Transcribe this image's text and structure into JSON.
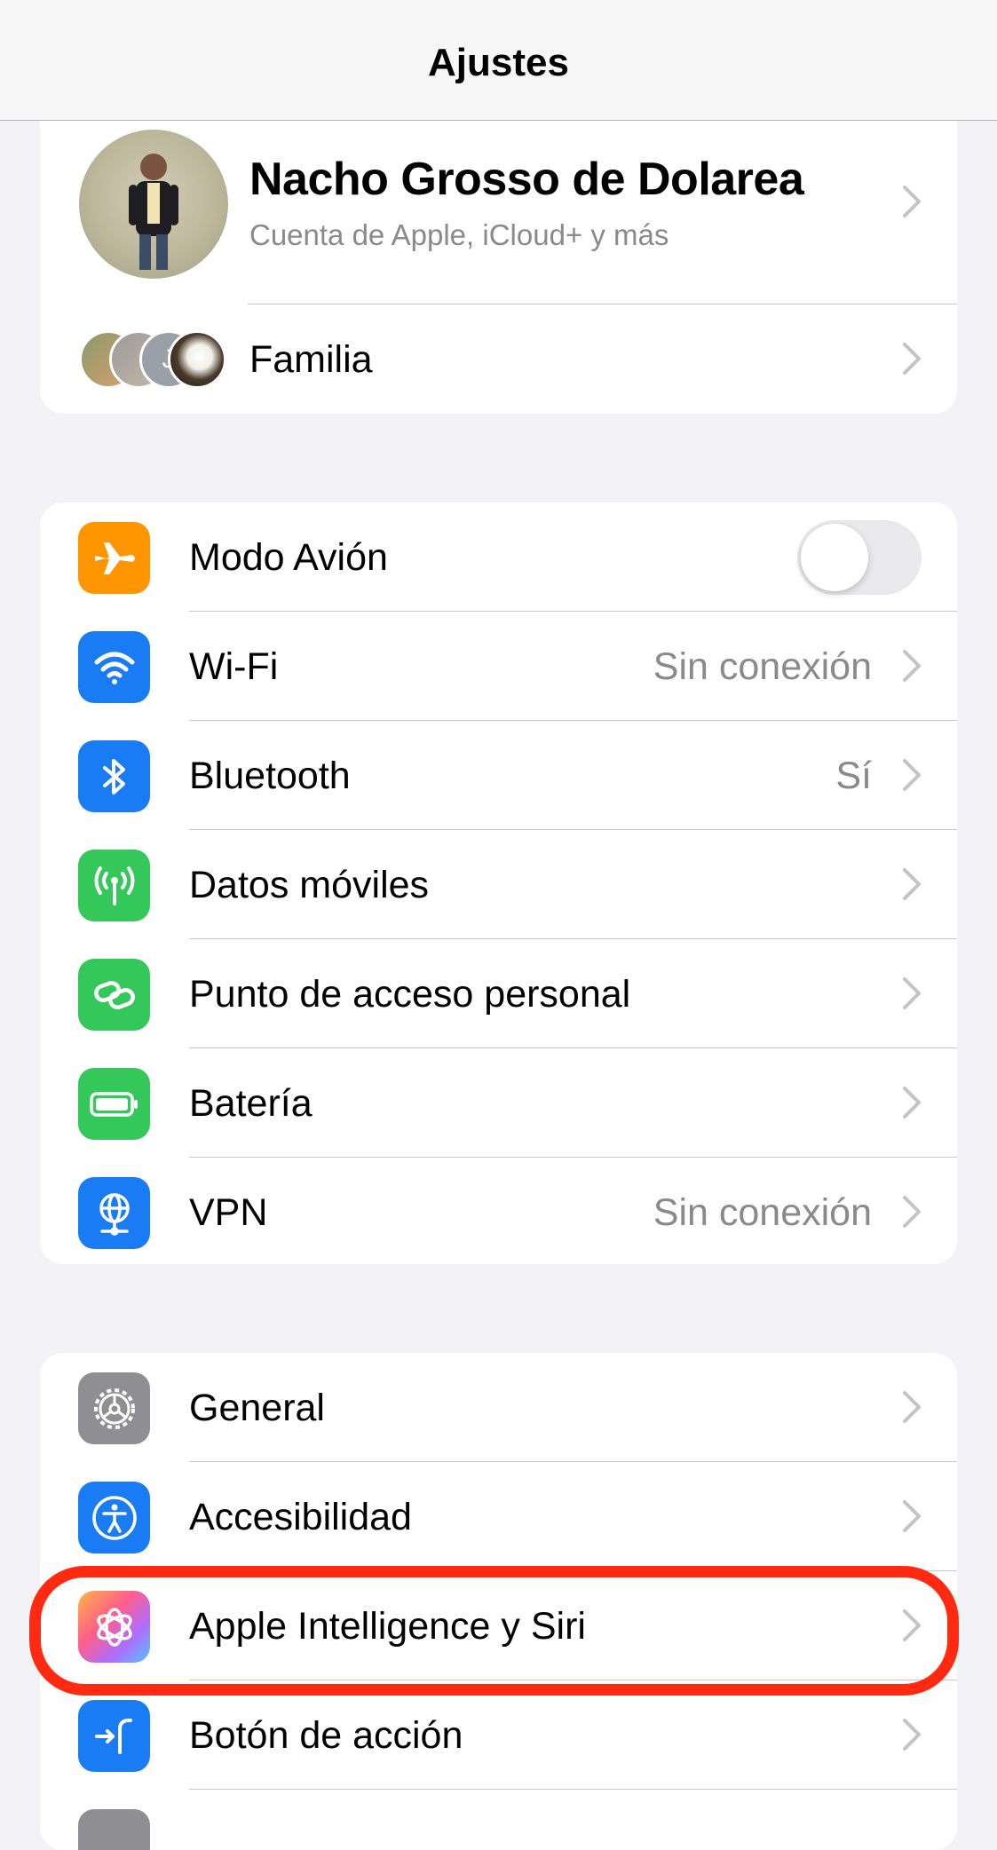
{
  "navbar": {
    "title": "Ajustes"
  },
  "profile": {
    "name": "Nacho Grosso de Dolarea",
    "subtitle": "Cuenta de Apple, iCloud+ y más",
    "family_initial": "J",
    "family_label": "Familia"
  },
  "network_group": [
    {
      "label": "Modo Avión",
      "value": null,
      "icon": "airplane-icon",
      "color": "#ff9500",
      "control": "toggle",
      "toggle_on": false
    },
    {
      "label": "Wi-Fi",
      "value": "Sin conexión",
      "icon": "wifi-icon",
      "color": "#1a7cf5",
      "control": "chevron"
    },
    {
      "label": "Bluetooth",
      "value": "Sí",
      "icon": "bluetooth-icon",
      "color": "#1a7cf5",
      "control": "chevron"
    },
    {
      "label": "Datos móviles",
      "value": null,
      "icon": "antenna-icon",
      "color": "#34c759",
      "control": "chevron"
    },
    {
      "label": "Punto de acceso personal",
      "value": null,
      "icon": "hotspot-link-icon",
      "color": "#34c759",
      "control": "chevron"
    },
    {
      "label": "Batería",
      "value": null,
      "icon": "battery-icon",
      "color": "#34c759",
      "control": "chevron"
    },
    {
      "label": "VPN",
      "value": "Sin conexión",
      "icon": "vpn-globe-icon",
      "color": "#1a7cf5",
      "control": "chevron"
    }
  ],
  "general_group": [
    {
      "label": "General",
      "icon": "gear-icon",
      "color": "#8e8e93"
    },
    {
      "label": "Accesibilidad",
      "icon": "accessibility-icon",
      "color": "#1a7cf5"
    },
    {
      "label": "Apple Intelligence y Siri",
      "icon": "apple-intelligence-icon",
      "color": "#ff6b9a",
      "highlighted": true
    },
    {
      "label": "Botón de acción",
      "icon": "action-button-icon",
      "color": "#1a7cf5"
    }
  ],
  "highlight_color": "#ff2a10"
}
